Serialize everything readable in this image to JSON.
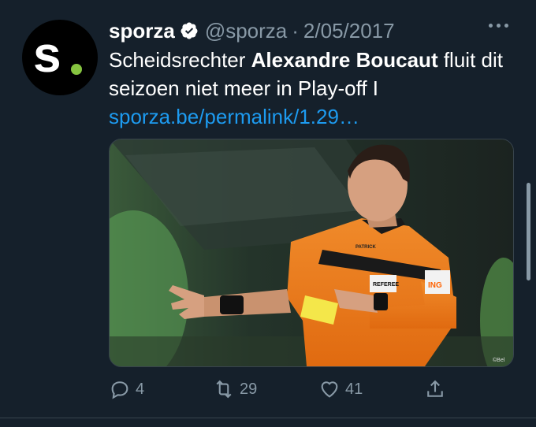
{
  "tweet": {
    "avatar_letter": "s",
    "name": "sporza",
    "handle": "@sporza",
    "separator": "·",
    "date": "2/05/2017",
    "text_part1": "Scheidsrechter ",
    "text_bold": "Alexandre Boucaut",
    "text_part2": " fluit dit seizoen niet meer in Play-off I",
    "link": "sporza.be/permalink/1.29…"
  },
  "media": {
    "description_icon": "referee-photo",
    "shirt_text": "REFEREE",
    "sponsor": "ING",
    "brand": "PATRICK",
    "watermark": "©Bel"
  },
  "actions": {
    "reply_count": "4",
    "retweet_count": "29",
    "like_count": "41"
  },
  "colors": {
    "background": "#15202b",
    "secondary_text": "#8899a6",
    "link": "#1d9bf0",
    "avatar_dot": "#86c440"
  }
}
